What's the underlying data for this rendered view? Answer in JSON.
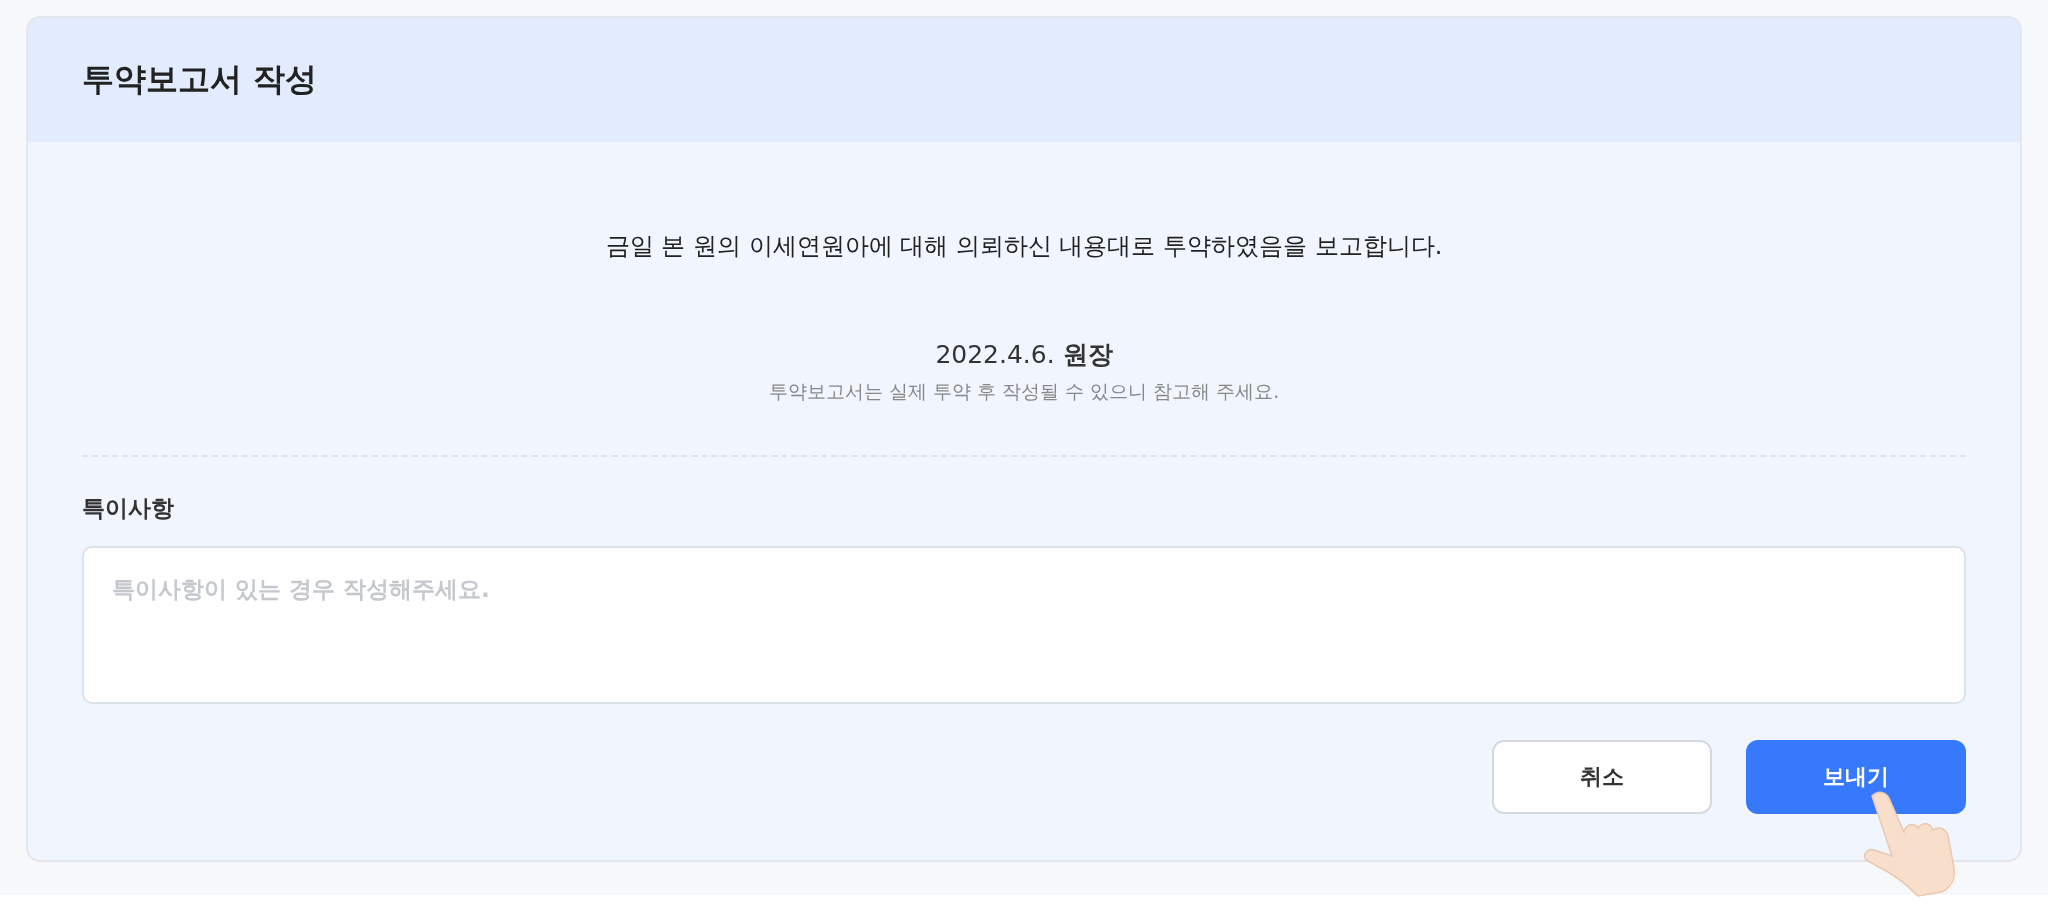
{
  "dialog": {
    "title": "투약보고서 작성",
    "message": "금일 본 원의 이세연원아에 대해 의뢰하신 내용대로 투약하였음을 보고합니다.",
    "signature": "2022.4.6. **원장**",
    "notice": "투약보고서는 실제 투약 후 작성될 수 있으니 참고해 주세요.",
    "remarks": {
      "label": "특이사항",
      "placeholder": "특이사항이 있는 경우 작성해주세요."
    },
    "buttons": [
      {
        "label": "취소",
        "kind": "secondary"
      },
      {
        "label": "보내기",
        "kind": "primary"
      }
    ]
  }
}
